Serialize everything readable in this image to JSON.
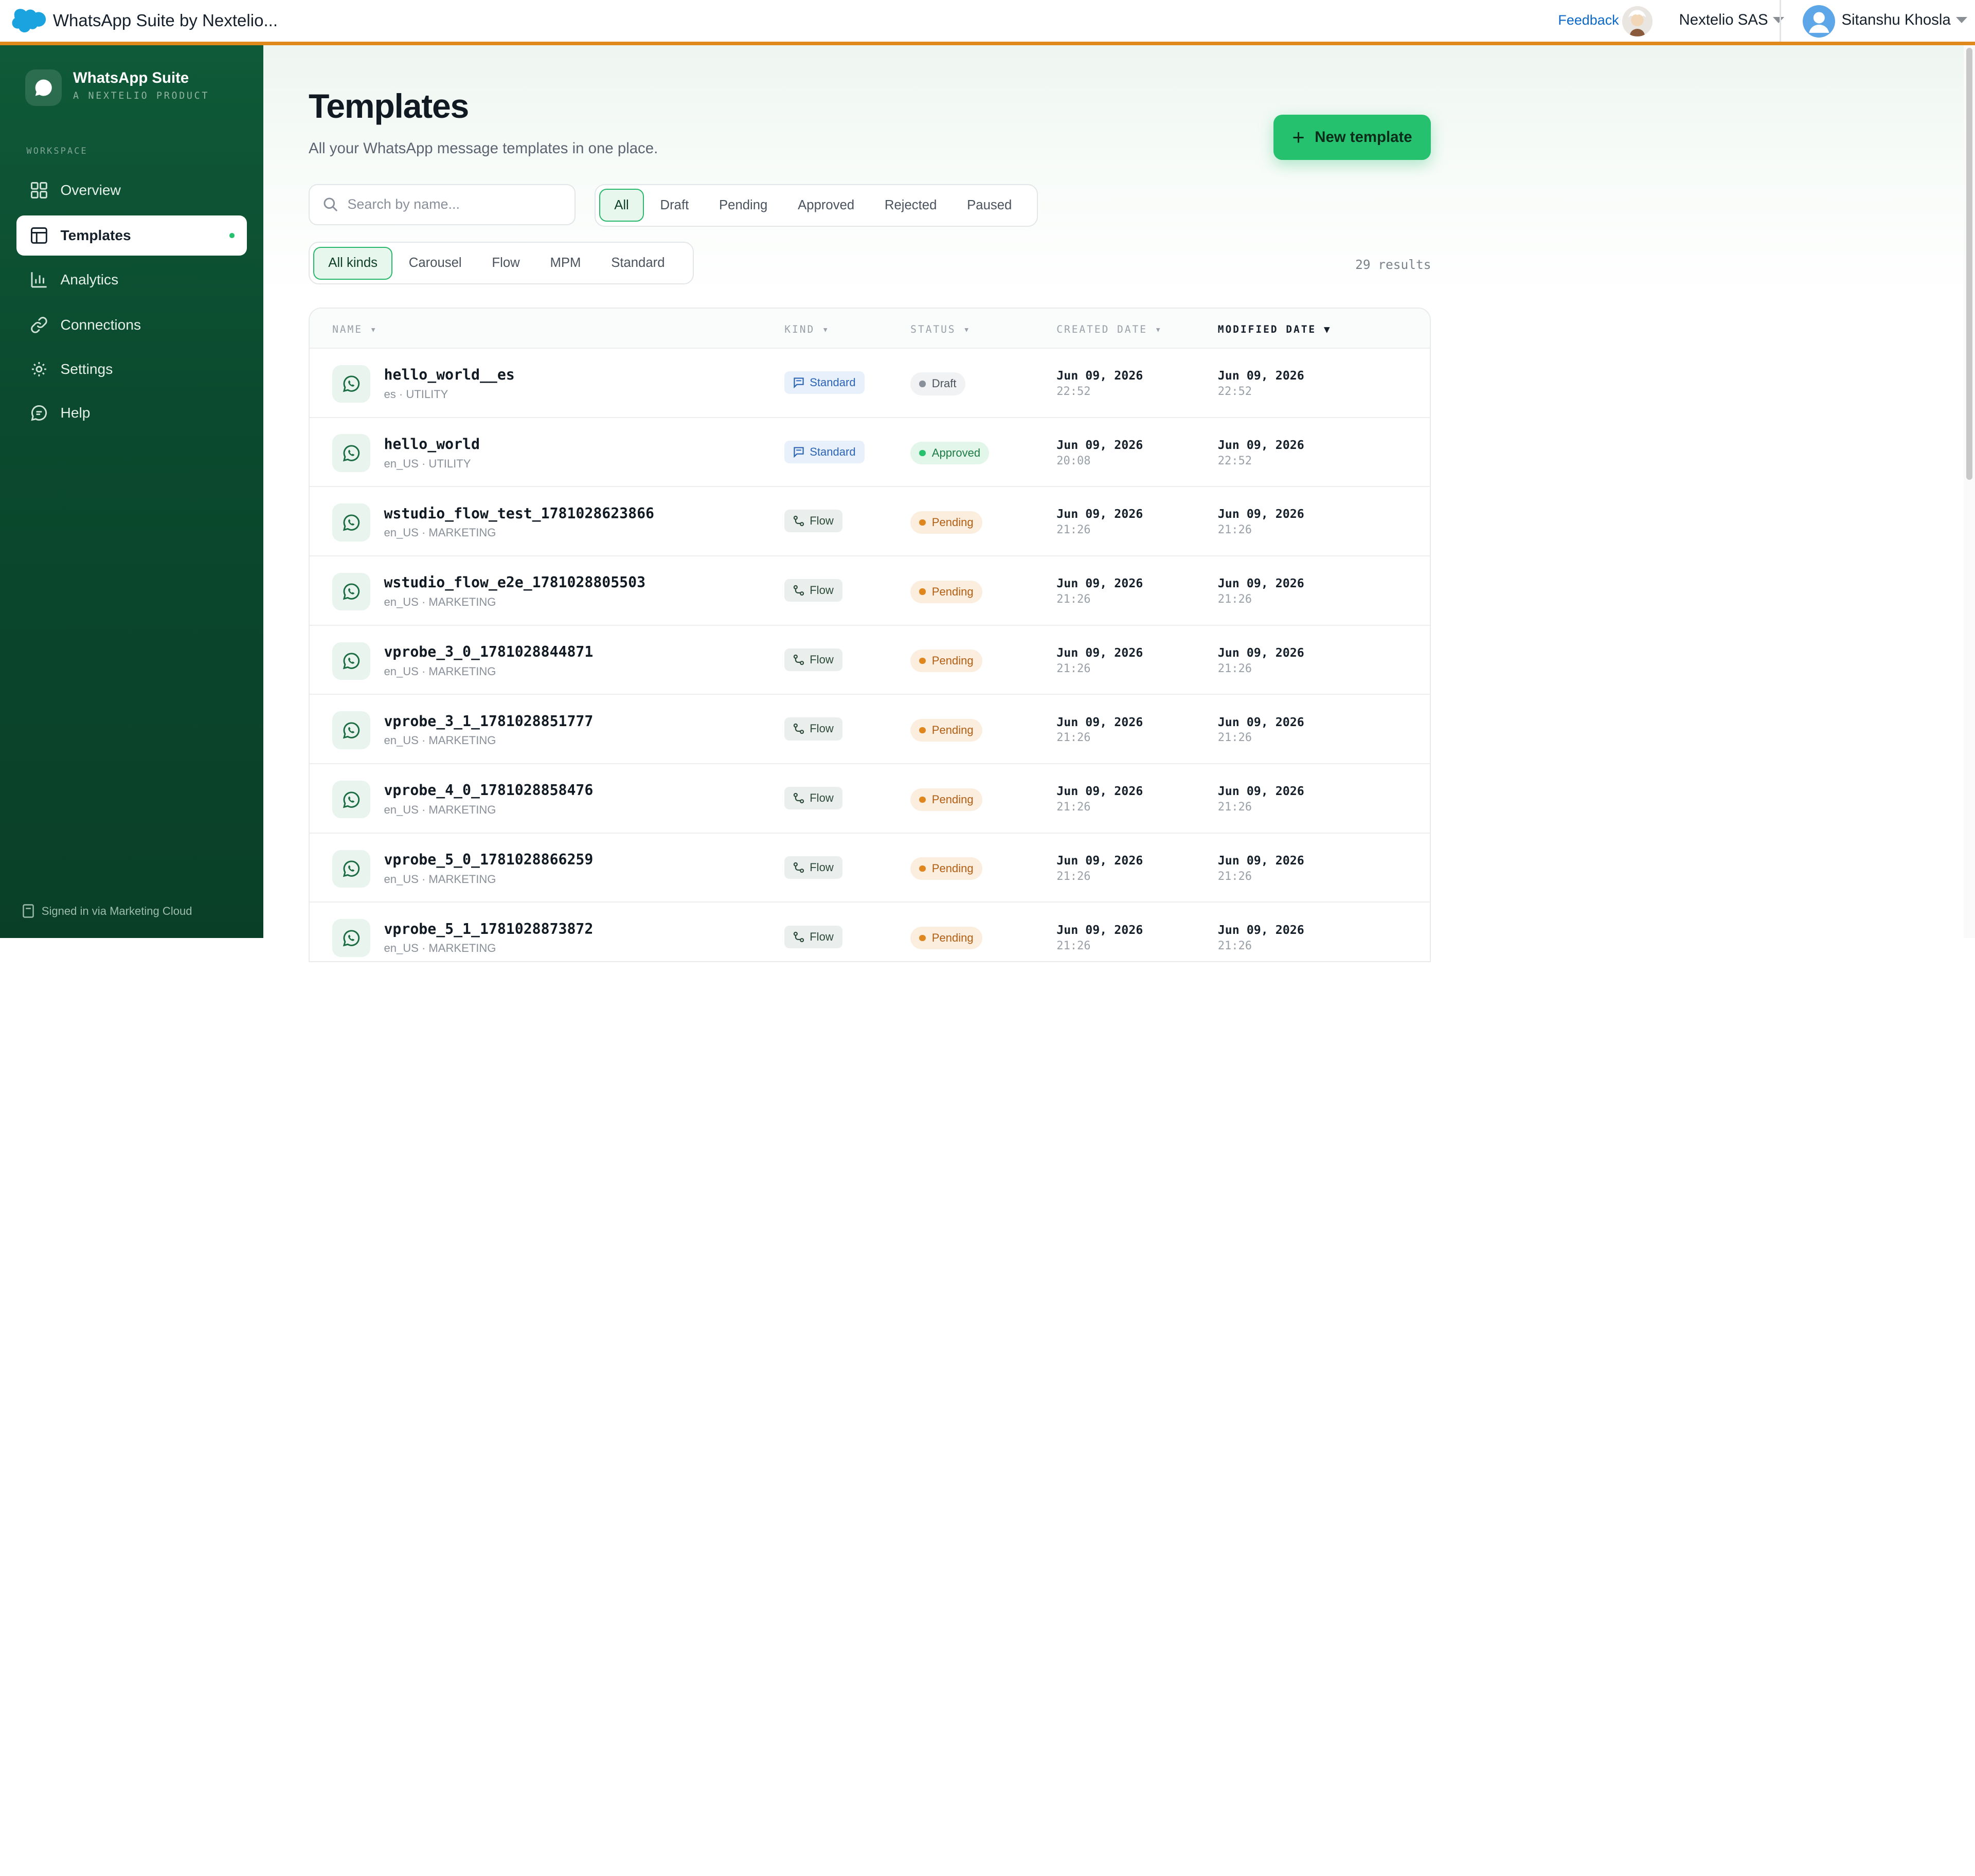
{
  "topbar": {
    "app_title": "WhatsApp Suite by Nextelio...",
    "feedback": "Feedback",
    "org": "Nextelio SAS",
    "user": "Sitanshu Khosla"
  },
  "sidebar": {
    "brand_name": "WhatsApp Suite",
    "brand_sub": "A NEXTELIO PRODUCT",
    "section": "WORKSPACE",
    "items": [
      {
        "label": "Overview",
        "icon": "grid-icon"
      },
      {
        "label": "Templates",
        "icon": "template-icon",
        "active": true
      },
      {
        "label": "Analytics",
        "icon": "bar-chart-icon"
      },
      {
        "label": "Connections",
        "icon": "link-icon"
      },
      {
        "label": "Settings",
        "icon": "gear-icon"
      },
      {
        "label": "Help",
        "icon": "chat-help-icon"
      }
    ],
    "signed_in": "Signed in via Marketing Cloud"
  },
  "page": {
    "title": "Templates",
    "subtitle": "All your WhatsApp message templates in one place.",
    "new_button": "New template",
    "search_placeholder": "Search by name...",
    "status_filters": [
      "All",
      "Draft",
      "Pending",
      "Approved",
      "Rejected",
      "Paused"
    ],
    "status_active": "All",
    "kind_filters": [
      "All kinds",
      "Carousel",
      "Flow",
      "MPM",
      "Standard"
    ],
    "kind_active": "All kinds",
    "results": "29 results"
  },
  "table": {
    "headers": [
      "NAME",
      "KIND",
      "STATUS",
      "CREATED DATE",
      "MODIFIED DATE"
    ],
    "sorted_column": "MODIFIED DATE",
    "rows": [
      {
        "name": "hello_world__es",
        "sub": "es · UTILITY",
        "kind": "Standard",
        "status": "Draft",
        "created_date": "Jun 09, 2026",
        "created_time": "22:52",
        "modified_date": "Jun 09, 2026",
        "modified_time": "22:52"
      },
      {
        "name": "hello_world",
        "sub": "en_US · UTILITY",
        "kind": "Standard",
        "status": "Approved",
        "created_date": "Jun 09, 2026",
        "created_time": "20:08",
        "modified_date": "Jun 09, 2026",
        "modified_time": "22:52"
      },
      {
        "name": "wstudio_flow_test_1781028623866",
        "sub": "en_US · MARKETING",
        "kind": "Flow",
        "status": "Pending",
        "created_date": "Jun 09, 2026",
        "created_time": "21:26",
        "modified_date": "Jun 09, 2026",
        "modified_time": "21:26"
      },
      {
        "name": "wstudio_flow_e2e_1781028805503",
        "sub": "en_US · MARKETING",
        "kind": "Flow",
        "status": "Pending",
        "created_date": "Jun 09, 2026",
        "created_time": "21:26",
        "modified_date": "Jun 09, 2026",
        "modified_time": "21:26"
      },
      {
        "name": "vprobe_3_0_1781028844871",
        "sub": "en_US · MARKETING",
        "kind": "Flow",
        "status": "Pending",
        "created_date": "Jun 09, 2026",
        "created_time": "21:26",
        "modified_date": "Jun 09, 2026",
        "modified_time": "21:26"
      },
      {
        "name": "vprobe_3_1_1781028851777",
        "sub": "en_US · MARKETING",
        "kind": "Flow",
        "status": "Pending",
        "created_date": "Jun 09, 2026",
        "created_time": "21:26",
        "modified_date": "Jun 09, 2026",
        "modified_time": "21:26"
      },
      {
        "name": "vprobe_4_0_1781028858476",
        "sub": "en_US · MARKETING",
        "kind": "Flow",
        "status": "Pending",
        "created_date": "Jun 09, 2026",
        "created_time": "21:26",
        "modified_date": "Jun 09, 2026",
        "modified_time": "21:26"
      },
      {
        "name": "vprobe_5_0_1781028866259",
        "sub": "en_US · MARKETING",
        "kind": "Flow",
        "status": "Pending",
        "created_date": "Jun 09, 2026",
        "created_time": "21:26",
        "modified_date": "Jun 09, 2026",
        "modified_time": "21:26"
      },
      {
        "name": "vprobe_5_1_1781028873872",
        "sub": "en_US · MARKETING",
        "kind": "Flow",
        "status": "Pending",
        "created_date": "Jun 09, 2026",
        "created_time": "21:26",
        "modified_date": "Jun 09, 2026",
        "modified_time": "21:26"
      }
    ]
  },
  "colors": {
    "accent": "#25c16f",
    "sidebar_bg": "#0b4a2e",
    "topbar_stripe": "#e08a1e"
  }
}
